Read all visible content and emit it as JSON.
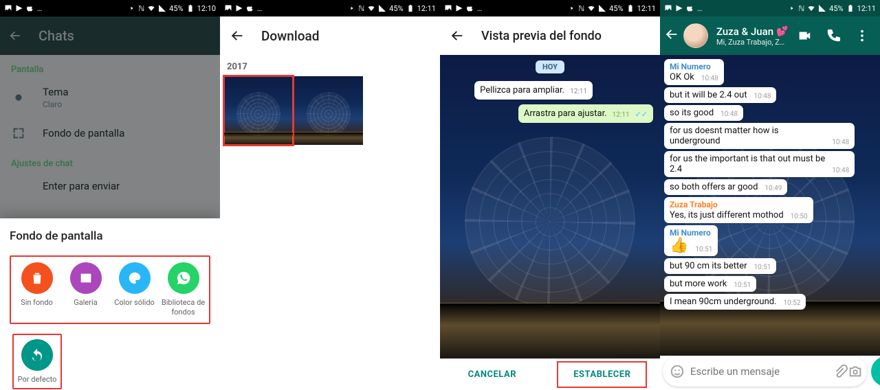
{
  "status": {
    "time_a": "12:10",
    "time_b": "12:11",
    "battery": "45%",
    "icons_left": [
      "image-icon",
      "play-icon",
      "apple-icon",
      "more-icon"
    ],
    "icons_right": [
      "mute-icon",
      "nfc-icon",
      "wifi-icon",
      "signal-icon"
    ]
  },
  "panel1": {
    "appbar_title": "Chats",
    "section_screen": "Pantalla",
    "theme_label": "Tema",
    "theme_value": "Claro",
    "wallpaper_label": "Fondo de pantalla",
    "section_chat": "Ajustes de chat",
    "enter_label": "Enter para enviar",
    "sheet_title": "Fondo de pantalla",
    "opts": [
      {
        "label": "Sin fondo",
        "color": "c-red",
        "icon": "trash-icon"
      },
      {
        "label": "Galería",
        "color": "c-purple",
        "icon": "gallery-icon"
      },
      {
        "label": "Color sólido",
        "color": "c-blue",
        "icon": "palette-icon"
      },
      {
        "label": "Biblioteca de fondos",
        "color": "c-green",
        "icon": "whatsapp-icon"
      }
    ],
    "opt_default": {
      "label": "Por defecto",
      "color": "c-teal",
      "icon": "undo-icon"
    }
  },
  "panel2": {
    "appbar_title": "Download",
    "year": "2017"
  },
  "panel3": {
    "appbar_title": "Vista previa del fondo",
    "date_chip": "HOY",
    "msg_in": "Pellizca para ampliar.",
    "msg_in_time": "12:11",
    "msg_out": "Arrastra para ajustar.",
    "msg_out_time": "12:11",
    "cancel": "CANCELAR",
    "set": "ESTABLECER"
  },
  "panel4": {
    "title": "Zuza & Juan",
    "hearts": "💕",
    "subtitle": "Mi, Zuza Trabajo, Zuzzan...",
    "input_placeholder": "Escribe un mensaje",
    "messages": [
      {
        "sender": "Mi Numero",
        "sender_color": "blue",
        "text": "OK Ok",
        "time": "10:48"
      },
      {
        "text": "but it will be 2.4 out",
        "time": "10:48"
      },
      {
        "text": "so its good",
        "time": "10:48"
      },
      {
        "text": "for us doesnt matter how is underground",
        "time": "10:48"
      },
      {
        "text": "for us the important is that out must be 2.4",
        "time": "10:48"
      },
      {
        "text": "so both offers ar good",
        "time": "10:49"
      },
      {
        "sender": "Zuza Trabajo",
        "sender_color": "orange",
        "text": "Yes, its just different mothod",
        "time": "10:50"
      },
      {
        "sender": "Mi Numero",
        "sender_color": "blue",
        "emoji": "👍",
        "time": "10:51"
      },
      {
        "text": "but 90 cm its better",
        "time": "10:51"
      },
      {
        "text": "but more work",
        "time": "10:51"
      },
      {
        "text": "I mean 90cm underground.",
        "time": "10:52"
      }
    ]
  }
}
